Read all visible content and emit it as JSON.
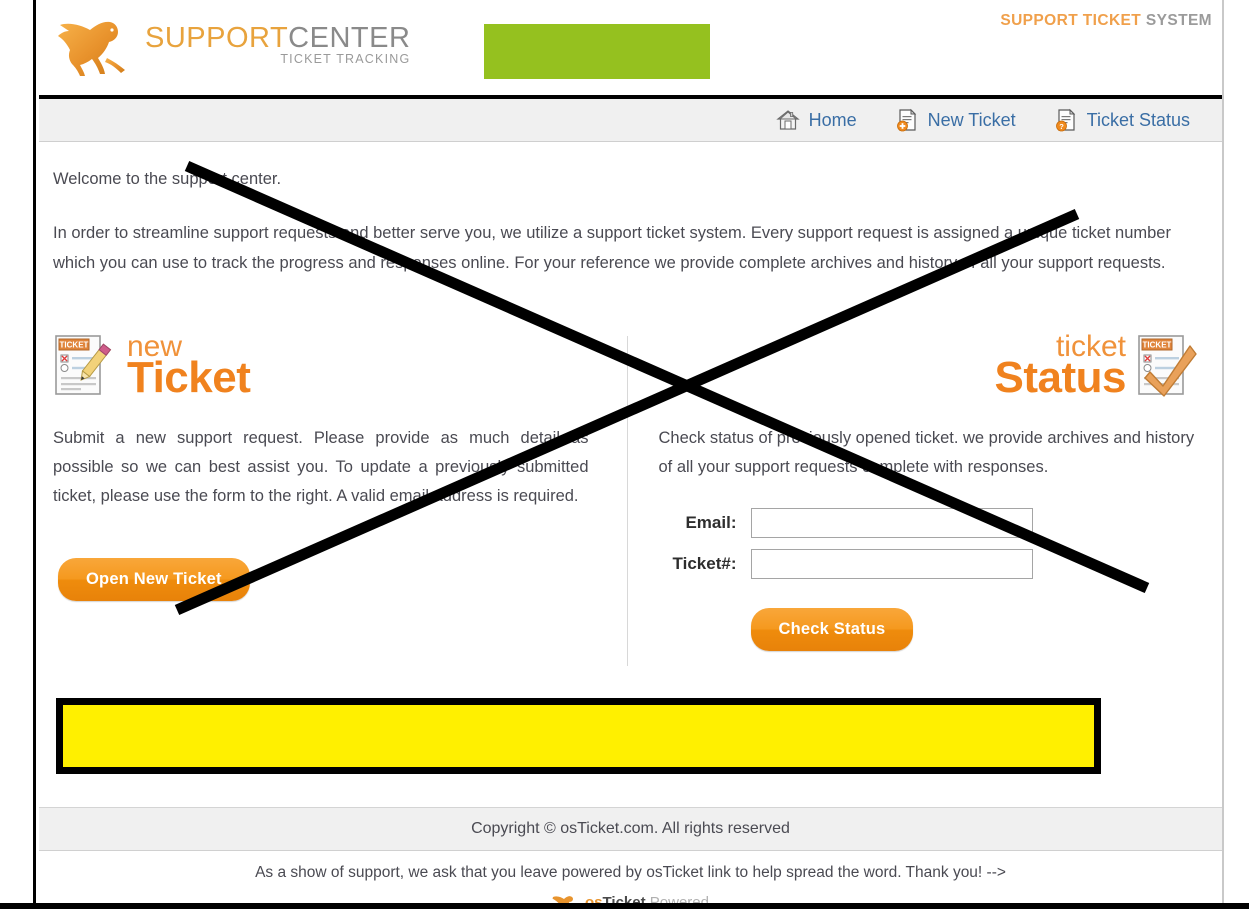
{
  "header": {
    "logo_title_part1": "SUPPORT",
    "logo_title_part2": "CENTER",
    "logo_subtitle": "TICKET TRACKING",
    "right_label_part1": "SUPPORT TICKET",
    "right_label_part2": " SYSTEM",
    "green_banner_color": "#95C11F"
  },
  "nav": {
    "items": [
      {
        "label": "Home",
        "icon": "home-icon"
      },
      {
        "label": "New Ticket",
        "icon": "new-ticket-icon"
      },
      {
        "label": "Ticket Status",
        "icon": "ticket-status-icon"
      }
    ]
  },
  "main": {
    "welcome": "Welcome to the support center.",
    "intro": "In order to streamline support requests and better serve you, we utilize a support ticket system. Every support request is assigned a unique ticket number which you can use to track the progress and responses online. For your reference we provide complete archives and history of all your support requests.",
    "new_ticket": {
      "heading_small": "new",
      "heading_big": "Ticket",
      "description": "Submit a new support request. Please provide as much detail as possible so we can best assist you. To update a previously submitted ticket, please use the form to the right. A valid email address is required.",
      "button_label": "Open New Ticket",
      "icon": "ticket-pencil-icon"
    },
    "ticket_status": {
      "heading_small": "ticket",
      "heading_big": "Status",
      "description": "Check status of previously opened ticket. we provide archives and history of all your support requests complete with responses.",
      "fields": [
        {
          "label": "Email:",
          "value": "",
          "name": "email-field"
        },
        {
          "label": "Ticket#:",
          "value": "",
          "name": "ticket-number-field"
        }
      ],
      "button_label": "Check Status",
      "icon": "ticket-check-icon"
    }
  },
  "footer": {
    "copyright": "Copyright © osTicket.com. All rights reserved",
    "support_note": "As a show of support, we ask that you leave powered by osTicket link to help spread the word. Thank you! -->",
    "powered_part1": "os",
    "powered_part2": "Ticket",
    "powered_part3": " Powered"
  },
  "annotations": {
    "cross_color": "#000000",
    "highlight_box_color": "#FFF000",
    "highlight_box_border": "#000000",
    "green_box_color": "#95C11F"
  }
}
